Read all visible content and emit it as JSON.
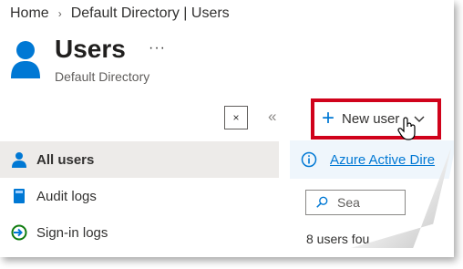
{
  "breadcrumb": {
    "home": "Home",
    "separator": "›",
    "current": "Default Directory | Users"
  },
  "header": {
    "title": "Users",
    "more": "···",
    "subtitle": "Default Directory"
  },
  "toolbar": {
    "collapse": "×",
    "chevrons": "«",
    "new_user_label": "New user"
  },
  "nav": {
    "items": [
      {
        "label": "All users",
        "icon": "user-icon",
        "active": true
      },
      {
        "label": "Audit logs",
        "icon": "book-icon",
        "active": false
      },
      {
        "label": "Sign-in logs",
        "icon": "sign-in-icon",
        "active": false
      }
    ]
  },
  "info": {
    "icon": "info-icon",
    "link": "Azure Active Dire"
  },
  "search": {
    "placeholder": "Sea",
    "icon": "search-icon"
  },
  "status": {
    "count_text": "8 users fou"
  },
  "colors": {
    "accent": "#0078d4",
    "highlight": "#d0021b",
    "active_nav": "#edebe9",
    "info_bg": "#eff6fc"
  }
}
